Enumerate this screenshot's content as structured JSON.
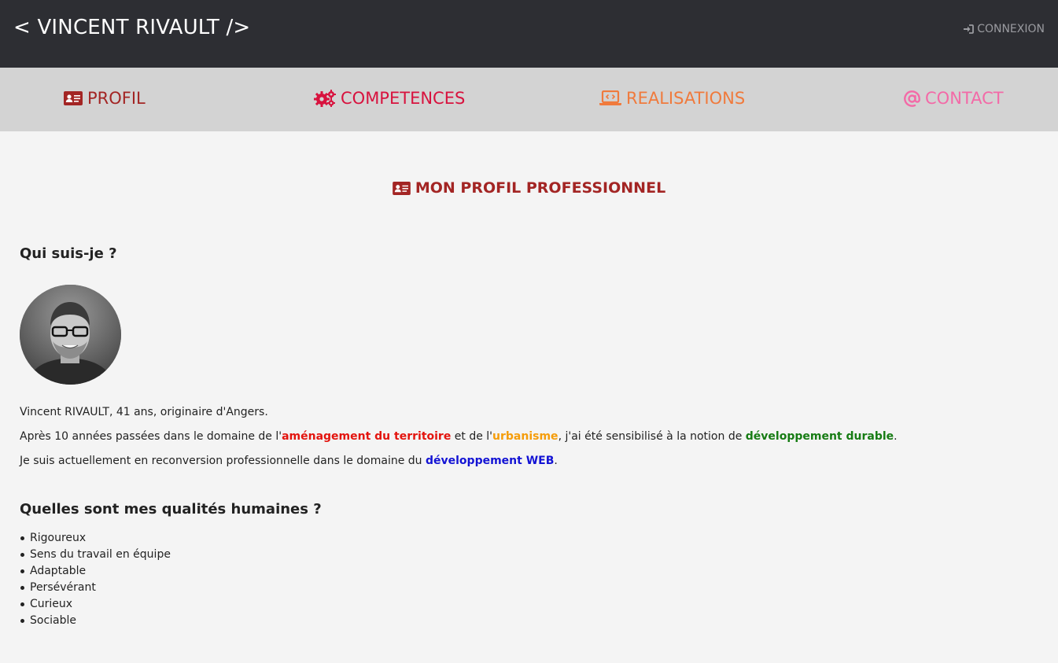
{
  "header": {
    "brand": "< VINCENT RIVAULT />",
    "login_label": "CONNEXION",
    "login_icon": "sign-in-icon"
  },
  "nav": {
    "items": [
      {
        "label": "PROFIL",
        "icon": "id-card-icon",
        "color": "#a32524"
      },
      {
        "label": "COMPETENCES",
        "icon": "gears-icon",
        "color": "#d8123e"
      },
      {
        "label": "REALISATIONS",
        "icon": "laptop-code-icon",
        "color": "#f07a3c"
      },
      {
        "label": "CONTACT",
        "icon": "at-icon",
        "color": "#f36aa7"
      }
    ]
  },
  "main": {
    "section_title": "MON PROFIL PROFESSIONNEL",
    "who_heading": "Qui suis-je ?",
    "bio": {
      "line1": "Vincent RIVAULT, 41 ans, originaire d'Angers.",
      "line2_a": "Après 10 années passées dans le domaine de l'",
      "line2_hl1": "aménagement du territoire",
      "line2_b": " et de l'",
      "line2_hl2": "urbanisme",
      "line2_c": ", j'ai été sensibilisé à la notion de ",
      "line2_hl3": "développement durable",
      "line2_d": ".",
      "line3_a": "Je suis actuellement en reconversion professionnelle dans le domaine du ",
      "line3_hl": "développement WEB",
      "line3_b": "."
    },
    "qualities_heading": "Quelles sont mes qualités humaines ?",
    "qualities": [
      "Rigoureux",
      "Sens du travail en équipe",
      "Adaptable",
      "Persévérant",
      "Curieux",
      "Sociable"
    ]
  },
  "colors": {
    "topbar": "#2d2e33",
    "navbar": "#d3d3d3",
    "page": "#f4f4f4",
    "accent": "#a32524"
  }
}
